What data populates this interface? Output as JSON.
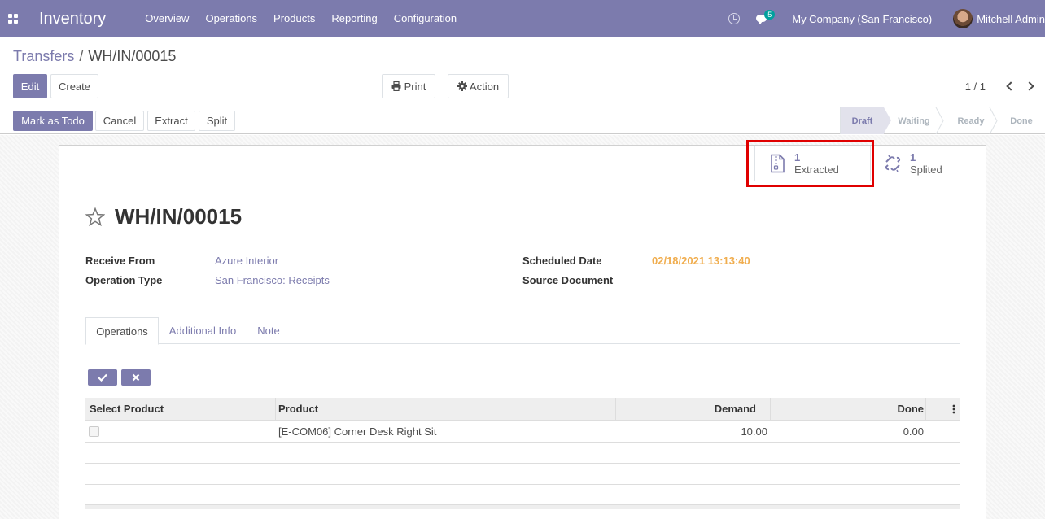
{
  "navbar": {
    "app_name": "Inventory",
    "menu": [
      "Overview",
      "Operations",
      "Products",
      "Reporting",
      "Configuration"
    ],
    "messages_count": "5",
    "company": "My Company (San Francisco)",
    "user": "Mitchell Admin"
  },
  "breadcrumb": {
    "parent": "Transfers",
    "separator": "/",
    "current": "WH/IN/00015"
  },
  "toolbar": {
    "edit": "Edit",
    "create": "Create",
    "print": "Print",
    "action": "Action"
  },
  "pager": {
    "value": "1 / 1"
  },
  "statusbar": {
    "buttons": [
      "Mark as Todo",
      "Cancel",
      "Extract",
      "Split"
    ],
    "stages": [
      "Draft",
      "Waiting",
      "Ready",
      "Done"
    ],
    "current_stage": "Draft"
  },
  "smart_buttons": [
    {
      "count": "1",
      "label": "Extracted",
      "icon": "file-zipper-icon"
    },
    {
      "count": "1",
      "label": "Splited",
      "icon": "chain-broken-icon"
    }
  ],
  "record": {
    "name": "WH/IN/00015",
    "fields_left": [
      {
        "label": "Receive From",
        "value": "Azure Interior"
      },
      {
        "label": "Operation Type",
        "value": "San Francisco: Receipts"
      }
    ],
    "fields_right": [
      {
        "label": "Scheduled Date",
        "value": "02/18/2021 13:13:40"
      },
      {
        "label": "Source Document",
        "value": ""
      }
    ]
  },
  "tabs": [
    "Operations",
    "Additional Info",
    "Note"
  ],
  "table": {
    "columns": [
      "Select Product",
      "Product",
      "Demand",
      "Done"
    ],
    "rows": [
      {
        "product": "[E-COM06] Corner Desk Right Sit",
        "demand": "10.00",
        "done": "0.00"
      }
    ]
  },
  "colors": {
    "brand": "#7c7bad",
    "date": "#f0ad4e",
    "highlight": "#e00000",
    "badge": "#00a09d"
  }
}
